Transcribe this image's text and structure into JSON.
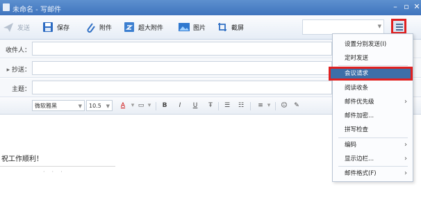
{
  "window": {
    "title": "未命名 - 写邮件"
  },
  "toolbar": {
    "send_label": "发送",
    "save_label": "保存",
    "attach_label": "附件",
    "big_attach_label": "超大附件",
    "image_label": "图片",
    "screenshot_label": "截屏"
  },
  "fields": {
    "to_label": "收件人：",
    "cc_label": "抄送：",
    "subject_label": "主题："
  },
  "format": {
    "font": "微软雅黑",
    "size": "10.5",
    "buttons": [
      "A",
      "B",
      "I",
      "U",
      "Ŧ"
    ]
  },
  "body": {
    "greeting": "祝工作顺利！"
  },
  "menu": {
    "items": [
      {
        "label": "设置分别发送(I)",
        "submenu": false
      },
      {
        "label": "定时发送",
        "submenu": false
      },
      {
        "label": "会议请求",
        "submenu": false,
        "highlighted": true
      },
      {
        "label": "阅读收条",
        "submenu": false
      },
      {
        "label": "邮件优先级",
        "submenu": true
      },
      {
        "label": "邮件加密...",
        "submenu": false
      },
      {
        "label": "拼写检查",
        "submenu": false
      },
      {
        "label": "编码",
        "submenu": true
      },
      {
        "label": "显示边栏...",
        "submenu": true
      },
      {
        "label": "邮件格式(F)",
        "submenu": true
      }
    ]
  },
  "colors": {
    "titlebar": "#4a7fc6",
    "highlight": "#3d6fa8",
    "annotation": "#e02020"
  }
}
